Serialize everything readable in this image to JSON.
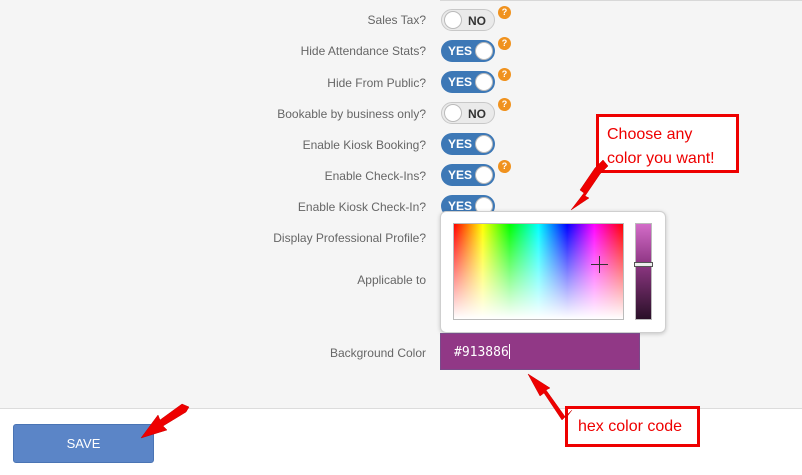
{
  "settings": {
    "rows": [
      {
        "label": "Sales Tax?",
        "state": "NO"
      },
      {
        "label": "Hide Attendance Stats?",
        "state": "YES"
      },
      {
        "label": "Hide From Public?",
        "state": "YES"
      },
      {
        "label": "Bookable by business only?",
        "state": "NO"
      },
      {
        "label": "Enable Kiosk Booking?",
        "state": "YES"
      },
      {
        "label": "Enable Check-Ins?",
        "state": "YES"
      },
      {
        "label": "Enable Kiosk Check-In?",
        "state": "YES"
      }
    ],
    "display_professional_profile_label": "Display Professional Profile?",
    "applicable_to_label": "Applicable to",
    "background_color_label": "Background Color",
    "help_glyph": "?"
  },
  "color_picker": {
    "value": "#913886",
    "selected_color": "#913886"
  },
  "footer": {
    "save_label": "SAVE"
  },
  "annotations": {
    "choose_color": "Choose any color you want!",
    "hex_code": "hex color code"
  },
  "colors": {
    "toggle_on": "#3d78b6",
    "help_badge": "#f0921e",
    "save_button": "#5b85c7",
    "annotation": "#e00000"
  },
  "icons": [
    "help-icon",
    "crosshair-icon",
    "text-caret"
  ]
}
